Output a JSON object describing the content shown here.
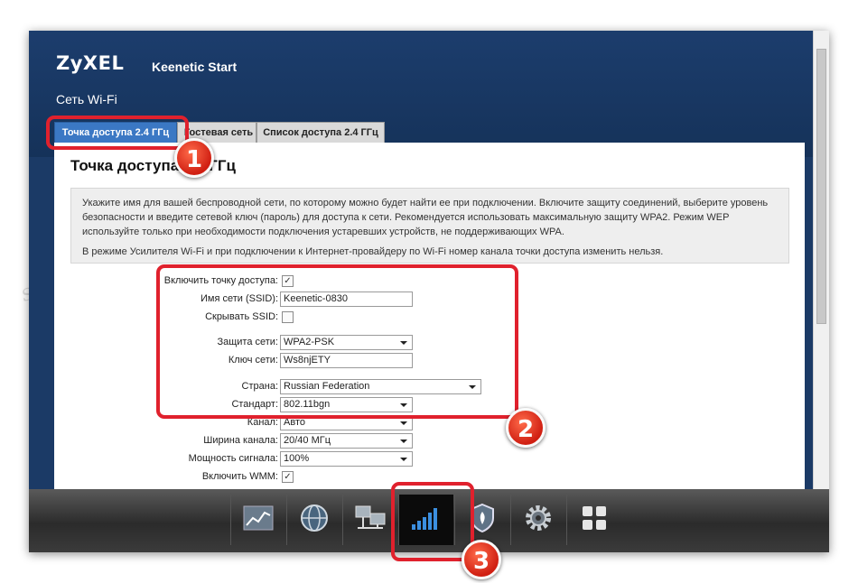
{
  "header": {
    "logo": "ZyXEL",
    "product": "Keenetic Start",
    "section_title": "Сеть Wi-Fi"
  },
  "tabs": [
    {
      "label": "Точка доступа 2.4 ГГц",
      "active": true
    },
    {
      "label": "Гостевая сеть",
      "active": false
    },
    {
      "label": "Список доступа 2.4 ГГц",
      "active": false
    }
  ],
  "page": {
    "heading": "Точка доступа 2.4 ГГц",
    "info_1": "Укажите имя для вашей беспроводной сети, по которому можно будет найти ее при подключении. Включите защиту соединений, выберите уровень безопасности и введите сетевой ключ (пароль) для доступа к сети. Рекомендуется использовать максимальную защиту WPA2. Режим WEP используйте только при необходимости подключения устаревших устройств, не поддерживающих WPA.",
    "info_2": "В режиме Усилителя Wi-Fi и при подключении к Интернет-провайдеру по Wi-Fi номер канала точки доступа изменить нельзя."
  },
  "form": {
    "enable_ap": {
      "label": "Включить точку доступа:",
      "checked": true,
      "mark": "✓"
    },
    "ssid": {
      "label": "Имя сети (SSID):",
      "value": "Keenetic-0830"
    },
    "hide_ssid": {
      "label": "Скрывать SSID:",
      "checked": false
    },
    "security": {
      "label": "Защита сети:",
      "value": "WPA2-PSK"
    },
    "key": {
      "label": "Ключ сети:",
      "value": "Ws8njETY"
    },
    "country": {
      "label": "Страна:",
      "value": "Russian Federation"
    },
    "standard": {
      "label": "Стандарт:",
      "value": "802.11bgn"
    },
    "channel": {
      "label": "Канал:",
      "value": "Авто"
    },
    "width": {
      "label": "Ширина канала:",
      "value": "20/40 МГц"
    },
    "power": {
      "label": "Мощность сигнала:",
      "value": "100%"
    },
    "wmm": {
      "label": "Включить WMM:",
      "checked": true,
      "mark": "✓"
    }
  },
  "toolbar": {
    "items": [
      "chart-icon",
      "globe-icon",
      "network-icon",
      "wifi-signal-icon",
      "shield-icon",
      "gear-icon",
      "apps-grid-icon"
    ],
    "active": "wifi-signal-icon"
  },
  "callouts": {
    "one": "1",
    "two": "2",
    "three": "3"
  },
  "watermark": "Soringpcrepair.Com",
  "colors": {
    "accent": "#3b78c4",
    "header": "#1b3a66",
    "callout": "#e0212d"
  }
}
